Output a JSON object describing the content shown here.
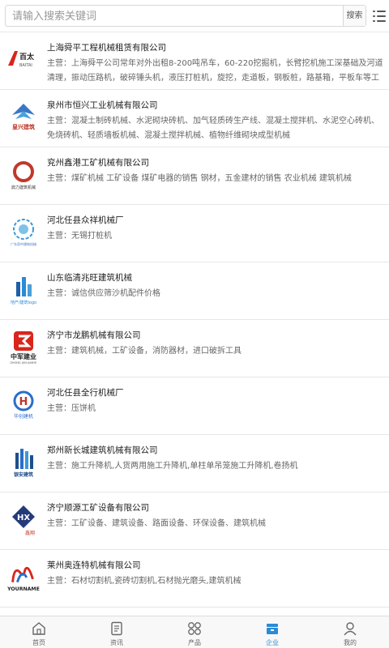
{
  "search": {
    "placeholder": "请输入搜索关键词",
    "button_label": "搜索"
  },
  "colors": {
    "accent": "#2a8bd6",
    "text": "#222222",
    "muted": "#666666"
  },
  "companies": [
    {
      "name": "上海舜平工程机械租赁有限公司",
      "desc": "主营：上海舜平公司常年对外出租8-200吨吊车，60-220挖掘机，长臂挖机施工深基础及河道清理，振动压路机，破碎锤头机，液压打桩机，旋挖，走道板，钢板桩，路基箱，平板车等工程施工设备。",
      "logo_text": "百太",
      "logo_sub": "BAITAI"
    },
    {
      "name": "泉州市恒兴工业机械有限公司",
      "desc": "主营：混凝土制砖机械、水泥砌块砖机、加气轻质砖生产线、混凝土搅拌机、水泥空心砖机、免烧砖机、轻质墙板机械、混凝土搅拌机械、植物纤维砌块成型机械",
      "logo_text": "皇兴建筑",
      "logo_sub": ""
    },
    {
      "name": "兖州鑫港工矿机械有限公司",
      "desc": "主营：煤矿机械 工矿设备 煤矿电器的销售 钢材，五金建材的销售 农业机械 建筑机械",
      "logo_text": "鼎力建筑机械",
      "logo_sub": ""
    },
    {
      "name": "河北任县众祥机械厂",
      "desc": "主营：无锡打桩机",
      "logo_text": "广东奇中建筑机械",
      "logo_sub": ""
    },
    {
      "name": "山东临清兆旺建筑机械",
      "desc": "主营：诚信供应筛沙机配件价格",
      "logo_text": "地产/建筑logo",
      "logo_sub": ""
    },
    {
      "name": "济宁市龙鹏机械有限公司",
      "desc": "主营：建筑机械，工矿设备，消防器材，进口破拆工具",
      "logo_text": "中军建业",
      "logo_sub": "ZHONG JUN JIANYE"
    },
    {
      "name": "河北任县全行机械厂",
      "desc": "主营：压饼机",
      "logo_text": "华创建机",
      "logo_sub": ""
    },
    {
      "name": "郑州新长城建筑机械有限公司",
      "desc": "主营：施工升降机,人货两用施工升降机,单柱单吊笼施工升降机,卷扬机",
      "logo_text": "银安建筑",
      "logo_sub": ""
    },
    {
      "name": "济宁顺源工矿设备有限公司",
      "desc": "主营：工矿设备、建筑设备、路面设备、环保设备、建筑机械",
      "logo_text": "鑫翔",
      "logo_sub": "HX"
    },
    {
      "name": "莱州奥连特机械有限公司",
      "desc": "主营：石材切割机,瓷砖切割机,石材抛光磨头,建筑机械",
      "logo_text": "YOURNAME",
      "logo_sub": ""
    }
  ],
  "tabs": [
    {
      "label": "首页",
      "icon": "home-icon",
      "active": false
    },
    {
      "label": "资讯",
      "icon": "document-icon",
      "active": false
    },
    {
      "label": "产品",
      "icon": "grid-icon",
      "active": false
    },
    {
      "label": "企业",
      "icon": "building-icon",
      "active": true
    },
    {
      "label": "我的",
      "icon": "user-icon",
      "active": false
    }
  ]
}
